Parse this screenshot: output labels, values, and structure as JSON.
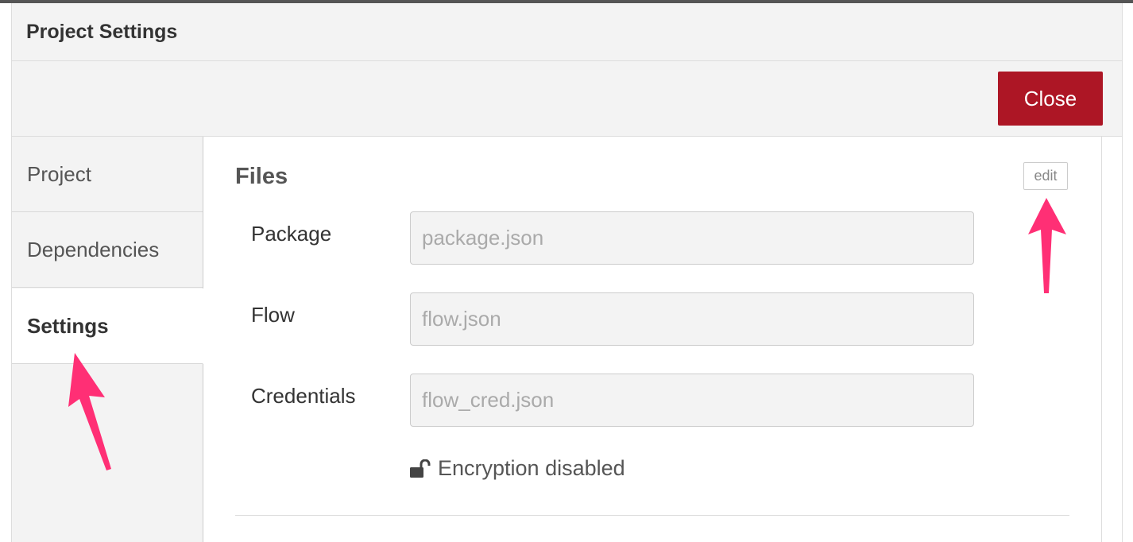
{
  "dialog": {
    "title": "Project Settings",
    "close_label": "Close"
  },
  "sidebar": {
    "tabs": [
      {
        "label": "Project",
        "active": false
      },
      {
        "label": "Dependencies",
        "active": false
      },
      {
        "label": "Settings",
        "active": true
      }
    ]
  },
  "files": {
    "title": "Files",
    "edit_label": "edit",
    "fields": [
      {
        "label": "Package",
        "value": "package.json"
      },
      {
        "label": "Flow",
        "value": "flow.json"
      },
      {
        "label": "Credentials",
        "value": "flow_cred.json"
      }
    ],
    "encryption_status": "Encryption disabled",
    "encryption_icon": "unlock-icon"
  },
  "annotations": {
    "arrow_color": "#ff2f75"
  },
  "colors": {
    "close_button": "#ad1625",
    "panel_background": "#f3f3f3"
  }
}
